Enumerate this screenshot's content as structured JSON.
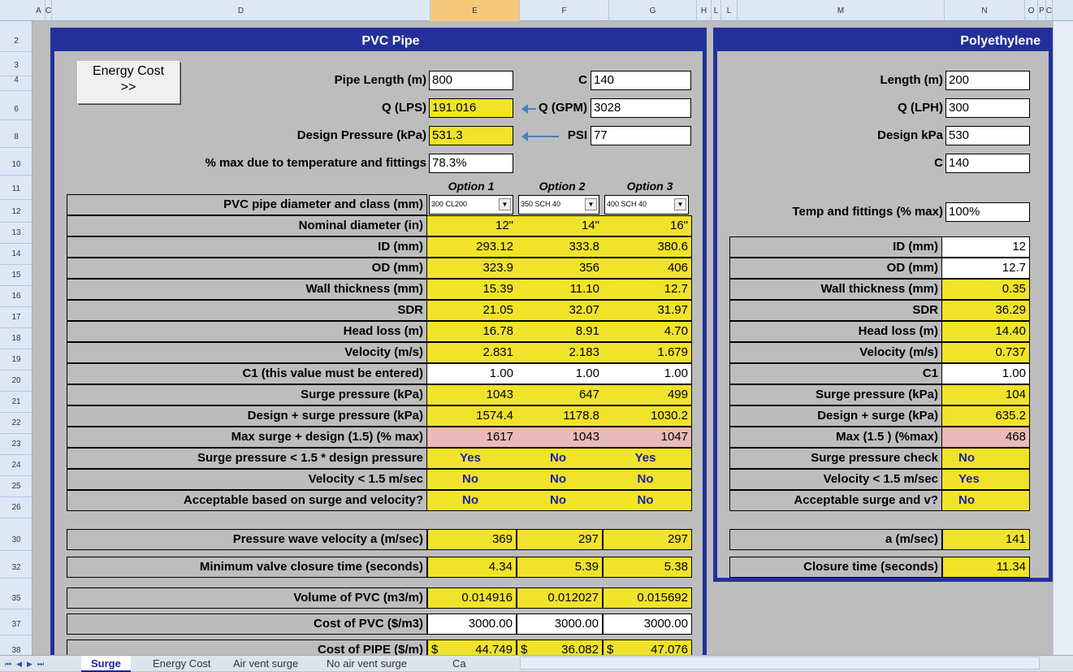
{
  "columns": [
    "A",
    "C",
    "D",
    "E",
    "F",
    "G",
    "H",
    "L",
    "L",
    "M",
    "N",
    "O",
    "P",
    "C"
  ],
  "rows": [
    "2",
    "3",
    "4",
    "6",
    "8",
    "10",
    "11",
    "12",
    "13",
    "14",
    "15",
    "16",
    "17",
    "18",
    "19",
    "20",
    "21",
    "22",
    "23",
    "24",
    "25",
    "26",
    "30",
    "32",
    "35",
    "37",
    "38"
  ],
  "pvc": {
    "title": "PVC Pipe",
    "energy_button": "Energy Cost\n>>",
    "pipe_length_label": "Pipe Length (m)",
    "pipe_length": "800",
    "c_label": "C",
    "c_value": "140",
    "q_lps_label": "Q (LPS)",
    "q_lps": "191.016",
    "q_gpm_label": "Q (GPM)",
    "q_gpm": "3028",
    "design_pressure_label": "Design Pressure (kPa)",
    "design_pressure": "531.3",
    "psi_label": "PSI",
    "psi": "77",
    "temp_label": "% max due to temperature and fittings",
    "temp": "78.3%",
    "options": [
      "Option 1",
      "Option 2",
      "Option 3"
    ],
    "dropdowns": [
      "300 CL200",
      "350 SCH 40",
      "400 SCH 40"
    ],
    "table": [
      {
        "label": "PVC pipe diameter and class (mm)",
        "vals": [
          "",
          "",
          ""
        ],
        "kind": "dd"
      },
      {
        "label": "Nominal diameter (in)",
        "vals": [
          "12\"",
          "14\"",
          "16\""
        ],
        "kind": "y"
      },
      {
        "label": "ID (mm)",
        "vals": [
          "293.12",
          "333.8",
          "380.6"
        ],
        "kind": "y"
      },
      {
        "label": "OD (mm)",
        "vals": [
          "323.9",
          "356",
          "406"
        ],
        "kind": "y"
      },
      {
        "label": "Wall thickness (mm)",
        "vals": [
          "15.39",
          "11.10",
          "12.7"
        ],
        "kind": "y"
      },
      {
        "label": "SDR",
        "vals": [
          "21.05",
          "32.07",
          "31.97"
        ],
        "kind": "y"
      },
      {
        "label": "Head loss (m)",
        "vals": [
          "16.78",
          "8.91",
          "4.70"
        ],
        "kind": "y"
      },
      {
        "label": "Velocity (m/s)",
        "vals": [
          "2.831",
          "2.183",
          "1.679"
        ],
        "kind": "y"
      },
      {
        "label": "C1 (this value must be entered)",
        "vals": [
          "1.00",
          "1.00",
          "1.00"
        ],
        "kind": "w"
      },
      {
        "label": "Surge pressure (kPa)",
        "vals": [
          "1043",
          "647",
          "499"
        ],
        "kind": "y"
      },
      {
        "label": "Design + surge pressure (kPa)",
        "vals": [
          "1574.4",
          "1178.8",
          "1030.2"
        ],
        "kind": "y"
      },
      {
        "label": "Max surge + design (1.5) (% max)",
        "vals": [
          "1617",
          "1043",
          "1047"
        ],
        "kind": "p"
      },
      {
        "label": "Surge pressure < 1.5 * design pressure",
        "vals": [
          "Yes",
          "No",
          "Yes"
        ],
        "kind": "yn"
      },
      {
        "label": "Velocity < 1.5 m/sec",
        "vals": [
          "No",
          "No",
          "No"
        ],
        "kind": "yn"
      },
      {
        "label": "Acceptable based on surge and velocity?",
        "vals": [
          "No",
          "No",
          "No"
        ],
        "kind": "yn"
      }
    ],
    "wave_label": "Pressure wave velocity a  (m/sec)",
    "wave": [
      "369",
      "297",
      "297"
    ],
    "closure_label": "Minimum valve closure time (seconds)",
    "closure": [
      "4.34",
      "5.39",
      "5.38"
    ],
    "volume_label": "Volume of PVC (m3/m)",
    "volume": [
      "0.014916",
      "0.012027",
      "0.015692"
    ],
    "costpvc_label": "Cost of PVC ($/m3)",
    "costpvc": [
      "3000.00",
      "3000.00",
      "3000.00"
    ],
    "costpipe_label": "Cost of PIPE ($/m)",
    "costpipe": [
      [
        "$",
        "44.749"
      ],
      [
        "$",
        "36.082"
      ],
      [
        "$",
        "47.076"
      ]
    ]
  },
  "pe": {
    "title": "Polyethylene",
    "length_label": "Length (m)",
    "length": "200",
    "q_label": "Q (LPH)",
    "q": "300",
    "dkpa_label": "Design kPa",
    "dkpa": "530",
    "c_label": "C",
    "c": "140",
    "temp_label": "Temp and fittings (% max)",
    "temp": "100%",
    "table": [
      {
        "label": "ID (mm)",
        "val": "12",
        "kind": "w"
      },
      {
        "label": "OD (mm)",
        "val": "12.7",
        "kind": "w"
      },
      {
        "label": "Wall thickness (mm)",
        "val": "0.35",
        "kind": "y"
      },
      {
        "label": "SDR",
        "val": "36.29",
        "kind": "y"
      },
      {
        "label": "Head loss (m)",
        "val": "14.40",
        "kind": "y"
      },
      {
        "label": "Velocity (m/s)",
        "val": "0.737",
        "kind": "y"
      },
      {
        "label": "C1",
        "val": "1.00",
        "kind": "w"
      },
      {
        "label": "Surge pressure (kPa)",
        "val": "104",
        "kind": "y"
      },
      {
        "label": "Design + surge (kPa)",
        "val": "635.2",
        "kind": "y"
      },
      {
        "label": "Max (1.5 ) (%max)",
        "val": "468",
        "kind": "p"
      },
      {
        "label": "Surge pressure check",
        "val": "No",
        "kind": "yn"
      },
      {
        "label": "Velocity < 1.5 m/sec",
        "val": "Yes",
        "kind": "yn"
      },
      {
        "label": "Acceptable  surge and v?",
        "val": "No",
        "kind": "yn"
      }
    ],
    "a_label": "a  (m/sec)",
    "a": "141",
    "closure_label": "Closure time (seconds)",
    "closure": "11.34"
  },
  "tabs": [
    "Surge",
    "Energy Cost",
    "Air vent surge",
    "No air vent surge",
    "Ca"
  ],
  "tab_nav": [
    "⏮",
    "◀",
    "▶",
    "⏭"
  ]
}
